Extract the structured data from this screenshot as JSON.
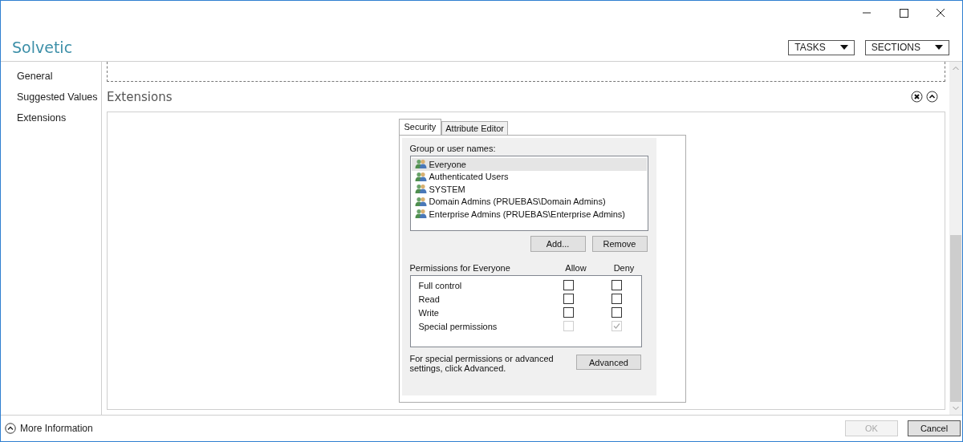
{
  "window": {
    "title": "Solvetic"
  },
  "header_buttons": [
    "TASKS",
    "SECTIONS"
  ],
  "sidebar": {
    "items": [
      {
        "label": "General"
      },
      {
        "label": "Suggested Values"
      },
      {
        "label": "Extensions"
      }
    ]
  },
  "section": {
    "title": "Extensions"
  },
  "dialog": {
    "tabs": [
      {
        "label": "Security",
        "selected": true
      },
      {
        "label": "Attribute Editor",
        "selected": false
      }
    ],
    "group_label": "Group or user names:",
    "users": [
      {
        "name": "Everyone",
        "selected": true
      },
      {
        "name": "Authenticated Users",
        "selected": false
      },
      {
        "name": "SYSTEM",
        "selected": false
      },
      {
        "name": "Domain Admins (PRUEBAS\\Domain Admins)",
        "selected": false
      },
      {
        "name": "Enterprise Admins (PRUEBAS\\Enterprise Admins)",
        "selected": false
      }
    ],
    "user_buttons": [
      "Add...",
      "Remove"
    ],
    "permissions_label": "Permissions for Everyone",
    "allow_label": "Allow",
    "deny_label": "Deny",
    "permissions": [
      {
        "name": "Full control",
        "allow": {
          "checked": false,
          "disabled": false
        },
        "deny": {
          "checked": false,
          "disabled": false
        }
      },
      {
        "name": "Read",
        "allow": {
          "checked": false,
          "disabled": false
        },
        "deny": {
          "checked": false,
          "disabled": false
        }
      },
      {
        "name": "Write",
        "allow": {
          "checked": false,
          "disabled": false
        },
        "deny": {
          "checked": false,
          "disabled": false
        }
      },
      {
        "name": "Special permissions",
        "allow": {
          "checked": false,
          "disabled": true
        },
        "deny": {
          "checked": true,
          "disabled": true
        }
      }
    ],
    "advanced_note": "For special permissions or advanced settings, click Advanced.",
    "advanced_button": "Advanced"
  },
  "footer": {
    "more_info": "More Information",
    "buttons": [
      {
        "label": "OK",
        "disabled": true
      },
      {
        "label": "Cancel",
        "disabled": false
      }
    ]
  }
}
